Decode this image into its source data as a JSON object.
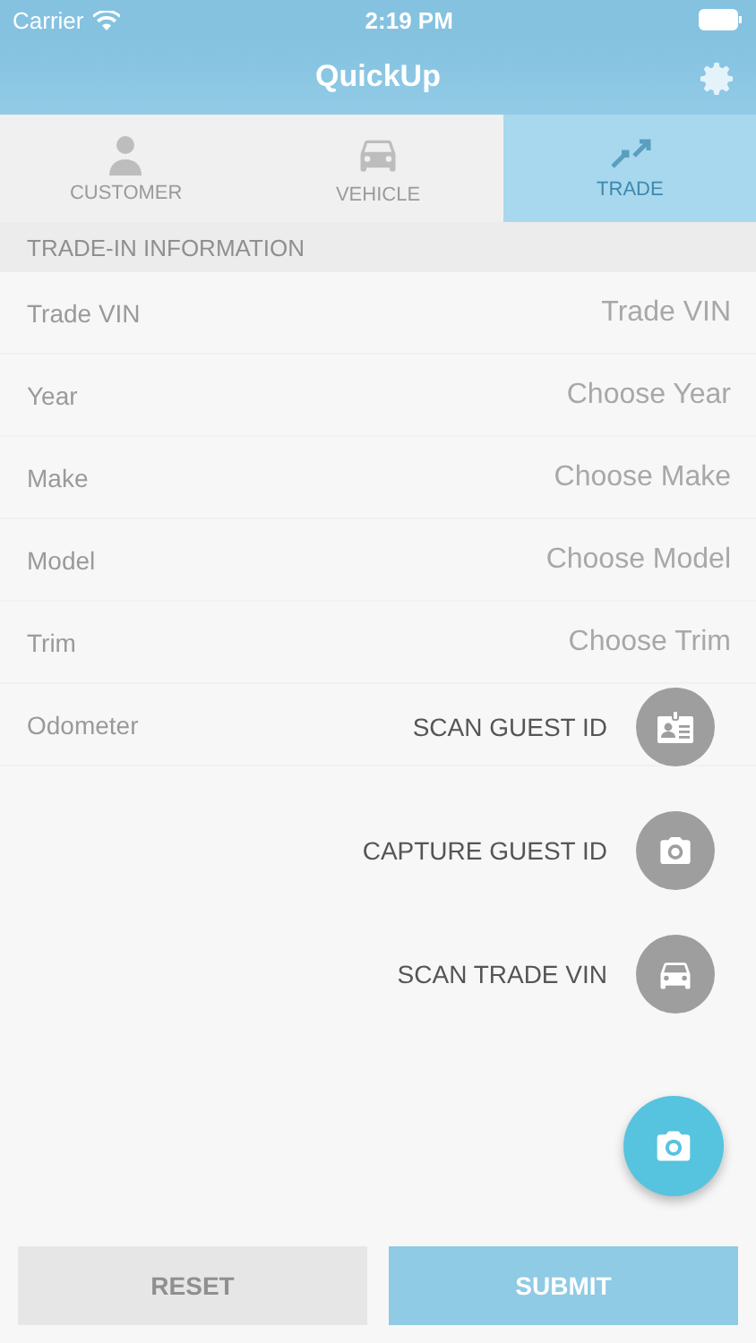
{
  "status_bar": {
    "carrier": "Carrier",
    "time": "2:19 PM"
  },
  "nav": {
    "title": "QuickUp"
  },
  "tabs": [
    {
      "label": "CUSTOMER",
      "kind": "person",
      "selected": false
    },
    {
      "label": "VEHICLE",
      "kind": "car",
      "selected": false
    },
    {
      "label": "TRADE",
      "kind": "swap",
      "selected": true
    }
  ],
  "section": {
    "title": "TRADE-IN INFORMATION"
  },
  "fields": [
    {
      "label": "Trade VIN",
      "placeholder": "Trade VIN"
    },
    {
      "label": "Year",
      "placeholder": "Choose Year"
    },
    {
      "label": "Make",
      "placeholder": "Choose Make"
    },
    {
      "label": "Model",
      "placeholder": "Choose Model"
    },
    {
      "label": "Trim",
      "placeholder": "Choose Trim"
    },
    {
      "label": "Odometer"
    }
  ],
  "buttons": [
    {
      "label": "RESET",
      "kind": "reset"
    },
    {
      "label": "SUBMIT",
      "kind": "submit"
    }
  ],
  "speed_dial": [
    {
      "label": "SCAN GUEST ID",
      "kind": "id"
    },
    {
      "label": "CAPTURE GUEST ID",
      "kind": "camera"
    },
    {
      "label": "SCAN TRADE VIN",
      "kind": "car"
    }
  ]
}
